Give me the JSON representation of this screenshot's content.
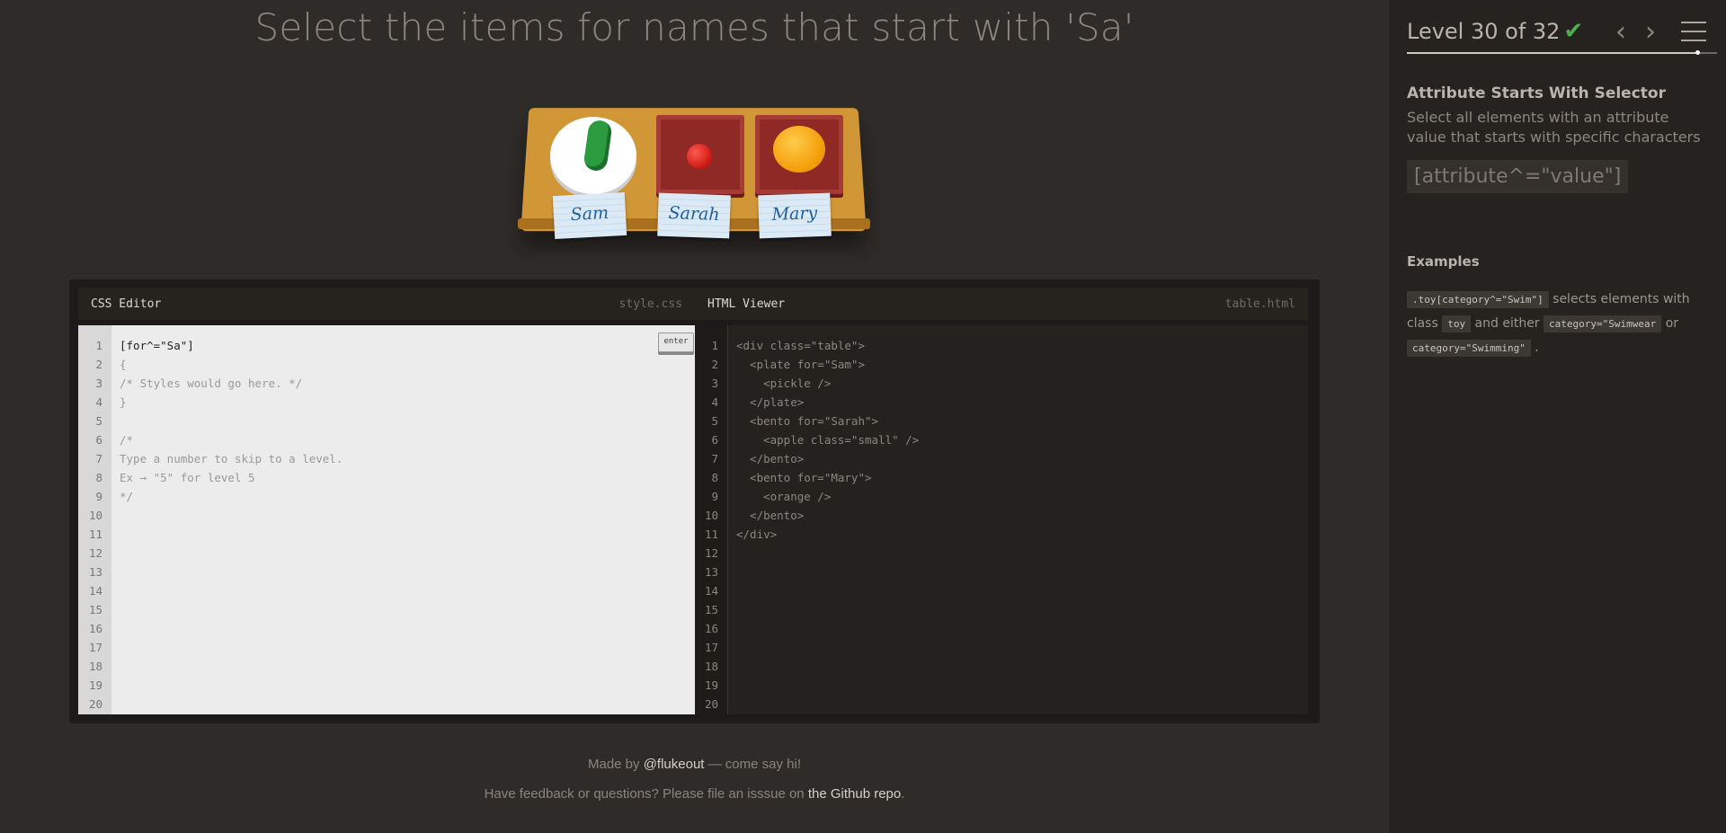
{
  "instruction": "Select the items for names that start with 'Sa'",
  "scene": {
    "tags": [
      "Sam",
      "Sarah",
      "Mary"
    ]
  },
  "css_editor": {
    "title": "CSS Editor",
    "file": "style.css",
    "enter_label": "enter",
    "lines": [
      "[for^=\"Sa\"]",
      "{",
      "/* Styles would go here. */",
      "}",
      "",
      "/*",
      "Type a number to skip to a level.",
      "Ex → \"5\" for level 5",
      "*/"
    ],
    "line_numbers": [
      "1",
      "2",
      "3",
      "4",
      "5",
      "6",
      "7",
      "8",
      "9",
      "10",
      "11",
      "12",
      "13",
      "14",
      "15",
      "16",
      "17",
      "18",
      "19",
      "20"
    ]
  },
  "html_viewer": {
    "title": "HTML Viewer",
    "file": "table.html",
    "lines": [
      "<div class=\"table\">",
      "  <plate for=\"Sam\">",
      "    <pickle />",
      "  </plate>",
      "  <bento for=\"Sarah\">",
      "    <apple class=\"small\" />",
      "  </bento>",
      "  <bento for=\"Mary\">",
      "    <orange />",
      "  </bento>",
      "</div>"
    ],
    "line_numbers": [
      "1",
      "2",
      "3",
      "4",
      "5",
      "6",
      "7",
      "8",
      "9",
      "10",
      "11",
      "12",
      "13",
      "14",
      "15",
      "16",
      "17",
      "18",
      "19",
      "20"
    ]
  },
  "footer": {
    "made_by": "Made by",
    "author": "@flukeout",
    "say_hi": " — come say hi!",
    "feedback": "Have feedback or questions? Please file an isssue on",
    "repo": "the Github repo",
    "period": "."
  },
  "sidebar": {
    "level": "Level 30 of 32",
    "check_icon": "✔",
    "prev_icon": "‹",
    "next_icon": "›",
    "progress": 0.9375,
    "selector_name": "Attribute Starts With Selector",
    "description": "Select all elements with an attribute value that starts with specific characters",
    "syntax": "[attribute^=\"value\"]",
    "examples_title": "Examples",
    "example": {
      "chip1": ".toy[category^=\"Swim\"]",
      "text1": " selects elements with class ",
      "chip2": "toy",
      "text2": " and either ",
      "chip3": "category=\"Swimwear",
      "text3": " or ",
      "chip4": "category=\"Swimming\"",
      "text4": " ."
    }
  }
}
